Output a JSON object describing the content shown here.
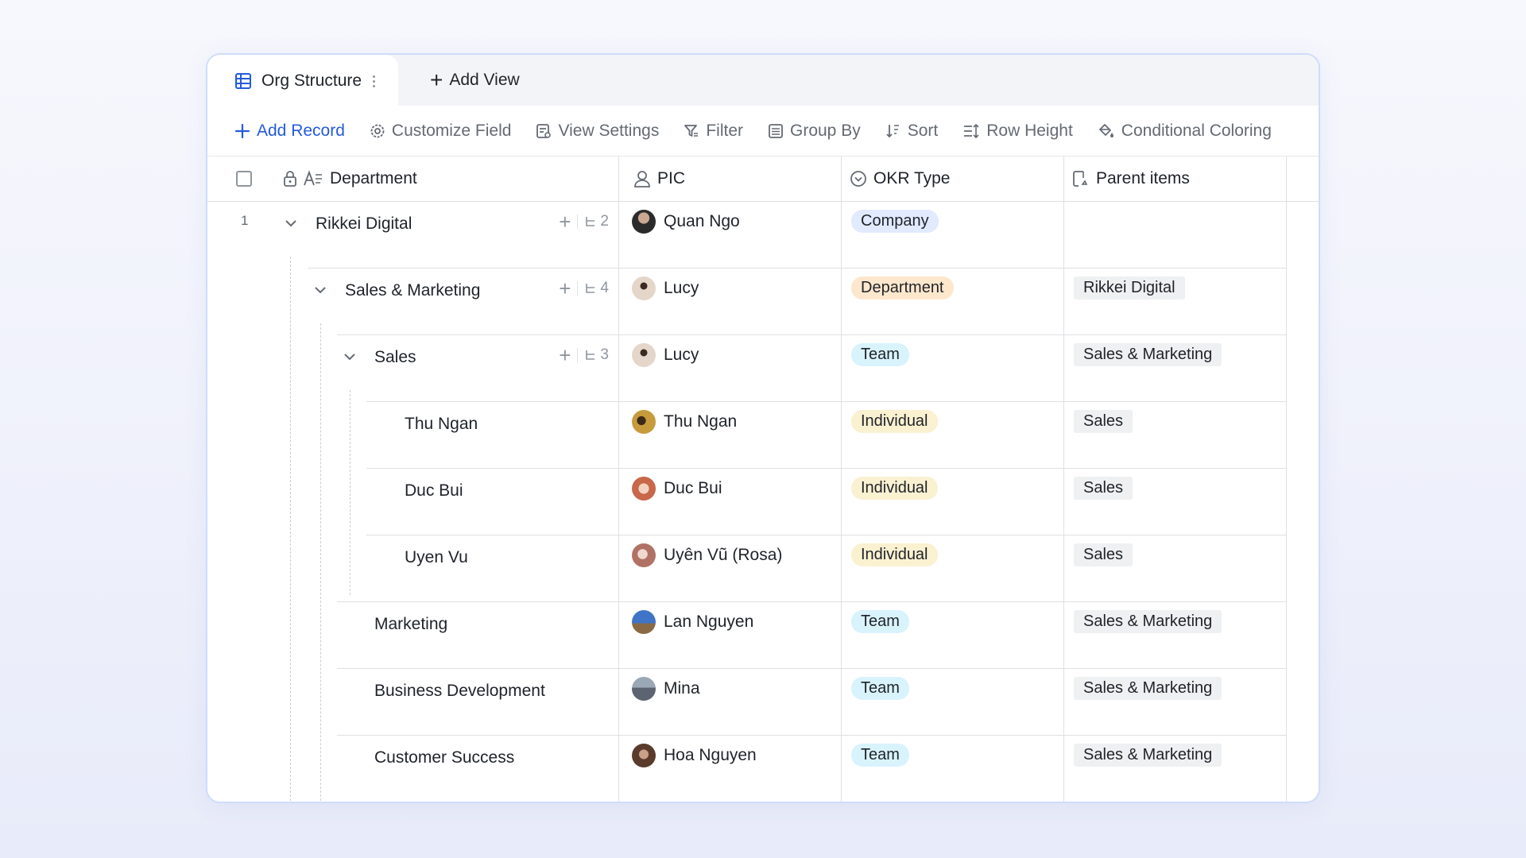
{
  "tabs": {
    "active_label": "Org Structure",
    "add_view_label": "Add View"
  },
  "toolbar": {
    "add_record": "Add Record",
    "customize_field": "Customize Field",
    "view_settings": "View Settings",
    "filter": "Filter",
    "group_by": "Group By",
    "sort": "Sort",
    "row_height": "Row Height",
    "conditional_coloring": "Conditional Coloring"
  },
  "columns": {
    "department": "Department",
    "pic": "PIC",
    "okr_type": "OKR Type",
    "parent_items": "Parent items"
  },
  "rows": [
    {
      "num": "1",
      "department": "Rikkei Digital",
      "children": "2",
      "pic": "Quan Ngo",
      "avatar": "#3b3b3b",
      "okr": "Company",
      "parent": ""
    },
    {
      "num": "",
      "department": "Sales & Marketing",
      "children": "4",
      "pic": "Lucy",
      "avatar": "#d8c2b0",
      "okr": "Department",
      "parent": "Rikkei Digital"
    },
    {
      "num": "",
      "department": "Sales",
      "children": "3",
      "pic": "Lucy",
      "avatar": "#d8c2b0",
      "okr": "Team",
      "parent": "Sales & Marketing"
    },
    {
      "num": "",
      "department": "Thu Ngan",
      "children": "",
      "pic": "Thu Ngan",
      "avatar": "#b9872f",
      "okr": "Individual",
      "parent": "Sales"
    },
    {
      "num": "",
      "department": "Duc Bui",
      "children": "",
      "pic": "Duc Bui",
      "avatar": "#e8a27c",
      "okr": "Individual",
      "parent": "Sales"
    },
    {
      "num": "",
      "department": "Uyen Vu",
      "children": "",
      "pic": "Uyên Vũ (Rosa)",
      "avatar": "#c98f84",
      "okr": "Individual",
      "parent": "Sales"
    },
    {
      "num": "",
      "department": "Marketing",
      "children": "",
      "pic": "Lan Nguyen",
      "avatar": "#4f7fc7",
      "okr": "Team",
      "parent": "Sales & Marketing"
    },
    {
      "num": "",
      "department": "Business Development",
      "children": "",
      "pic": "Mina",
      "avatar": "#7f8a95",
      "okr": "Team",
      "parent": "Sales & Marketing"
    },
    {
      "num": "",
      "department": "Customer Success",
      "children": "",
      "pic": "Hoa Nguyen",
      "avatar": "#6b4a3a",
      "okr": "Team",
      "parent": "Sales & Marketing"
    }
  ],
  "colors": {
    "accent": "#245bdb",
    "company_tag": "#e1eaff",
    "department_tag": "#fee7cd",
    "team_tag": "#d9f3fd",
    "individual_tag": "#faf1d1"
  }
}
